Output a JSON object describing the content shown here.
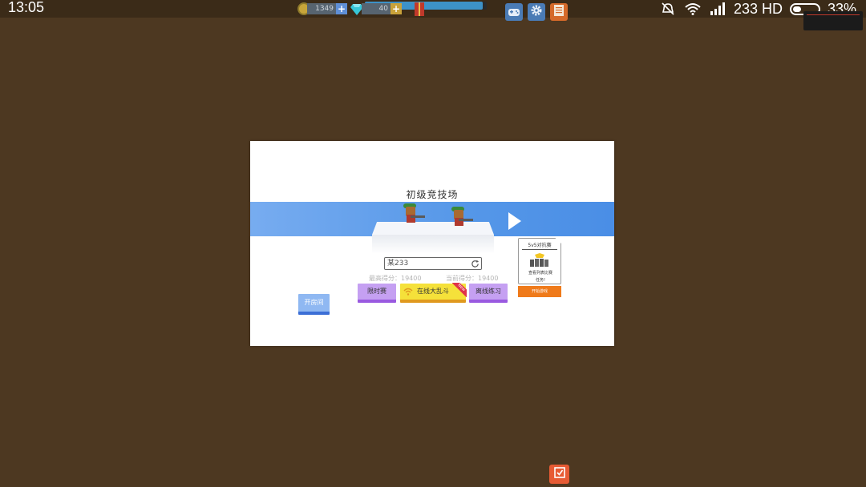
{
  "status_bar": {
    "time": "13:05",
    "network_label": "233 HD",
    "battery_percent": "33%",
    "battery_level": 0.33,
    "icons": [
      "alarm-mute-icon",
      "wifi-icon",
      "signal-icon",
      "battery-icon"
    ]
  },
  "resources": {
    "coins": "1349",
    "gems": "40",
    "xp_progress": 0.97
  },
  "toolbar": {
    "icons": [
      "gamepad-icon",
      "gear-icon",
      "book-icon"
    ]
  },
  "game": {
    "title": "初级竞技场",
    "player_name": "某233",
    "best_score": "最高得分：19400",
    "current_score": "当前得分：19400",
    "buttons": {
      "timed": "限时赛",
      "brawl": "在线大乱斗",
      "offline": "离线练习",
      "open_room": "开房间"
    },
    "new_badge": "New",
    "card": {
      "title": "5v5对抗赛",
      "desc_line1": "查看列表比赛",
      "desc_line2": "任务!",
      "button": "开始游戏"
    }
  },
  "colors": {
    "background": "#4d3821",
    "sky": "#5597e8",
    "purple_button": "#c5a0f2",
    "yellow_button": "#f5e13a",
    "blue_button": "#8fb8f2",
    "orange_button": "#ef7a1a"
  }
}
